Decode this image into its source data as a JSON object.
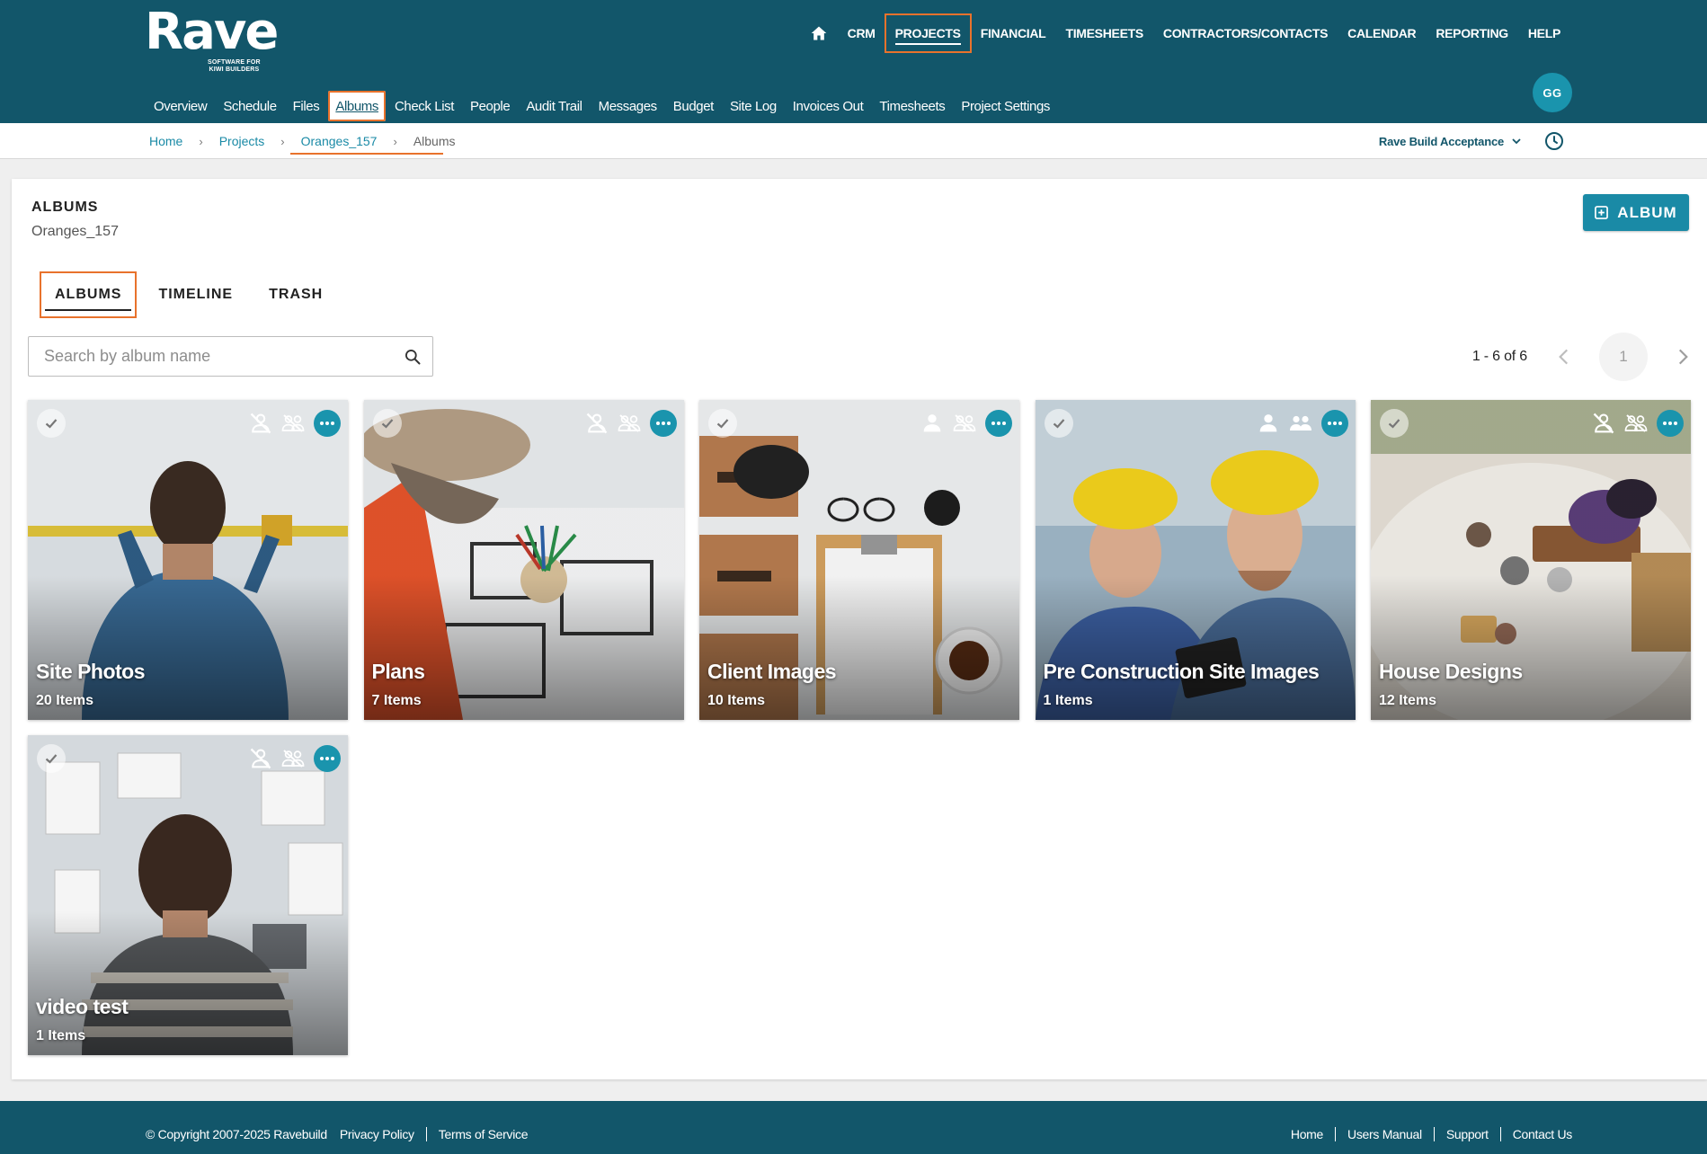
{
  "brand": {
    "name": "Rave",
    "tagline_line1": "SOFTWARE FOR",
    "tagline_line2": "KIWI BUILDERS"
  },
  "top_nav": [
    {
      "label": "CRM"
    },
    {
      "label": "PROJECTS",
      "active": true
    },
    {
      "label": "FINANCIAL"
    },
    {
      "label": "TIMESHEETS"
    },
    {
      "label": "CONTRACTORS/CONTACTS"
    },
    {
      "label": "CALENDAR"
    },
    {
      "label": "REPORTING"
    },
    {
      "label": "HELP"
    }
  ],
  "sub_nav": [
    {
      "label": "Overview"
    },
    {
      "label": "Schedule"
    },
    {
      "label": "Files"
    },
    {
      "label": "Albums",
      "active": true
    },
    {
      "label": "Check List"
    },
    {
      "label": "People"
    },
    {
      "label": "Audit Trail"
    },
    {
      "label": "Messages"
    },
    {
      "label": "Budget"
    },
    {
      "label": "Site Log"
    },
    {
      "label": "Invoices Out"
    },
    {
      "label": "Timesheets"
    },
    {
      "label": "Project Settings"
    }
  ],
  "user": {
    "initials": "GG"
  },
  "breadcrumb": [
    {
      "label": "Home"
    },
    {
      "label": "Projects"
    },
    {
      "label": "Oranges_157"
    },
    {
      "label": "Albums",
      "current": true
    }
  ],
  "company": {
    "name": "Rave Build Acceptance"
  },
  "page": {
    "title": "ALBUMS",
    "subtitle": "Oranges_157",
    "add_button": "ALBUM"
  },
  "tabs": [
    {
      "label": "ALBUMS",
      "active": true
    },
    {
      "label": "TIMELINE"
    },
    {
      "label": "TRASH"
    }
  ],
  "search": {
    "placeholder": "Search by album name",
    "value": ""
  },
  "pagination": {
    "range": "1 - 6 of 6",
    "current_page": "1"
  },
  "albums": [
    {
      "name": "Site Photos",
      "count": "20 Items",
      "client_visible": false,
      "contractor_visible": false,
      "theme": "site"
    },
    {
      "name": "Plans",
      "count": "7 Items",
      "client_visible": false,
      "contractor_visible": false,
      "theme": "plans"
    },
    {
      "name": "Client Images",
      "count": "10 Items",
      "client_visible": true,
      "contractor_visible": false,
      "theme": "desk"
    },
    {
      "name": "Pre Construction Site Images",
      "count": "1 Items",
      "client_visible": true,
      "contractor_visible": true,
      "theme": "workers"
    },
    {
      "name": "House Designs",
      "count": "12 Items",
      "client_visible": false,
      "contractor_visible": false,
      "theme": "picnic"
    },
    {
      "name": "video test",
      "count": "1 Items",
      "client_visible": false,
      "contractor_visible": false,
      "theme": "board"
    }
  ],
  "footer": {
    "copyright": "© Copyright 2007-2025 Ravebuild",
    "left_links": [
      "Privacy Policy",
      "Terms of Service"
    ],
    "right_links": [
      "Home",
      "Users Manual",
      "Support",
      "Contact Us"
    ]
  },
  "colors": {
    "header": "#12566a",
    "accent": "#1a8aa6",
    "highlight": "#e8722c"
  }
}
